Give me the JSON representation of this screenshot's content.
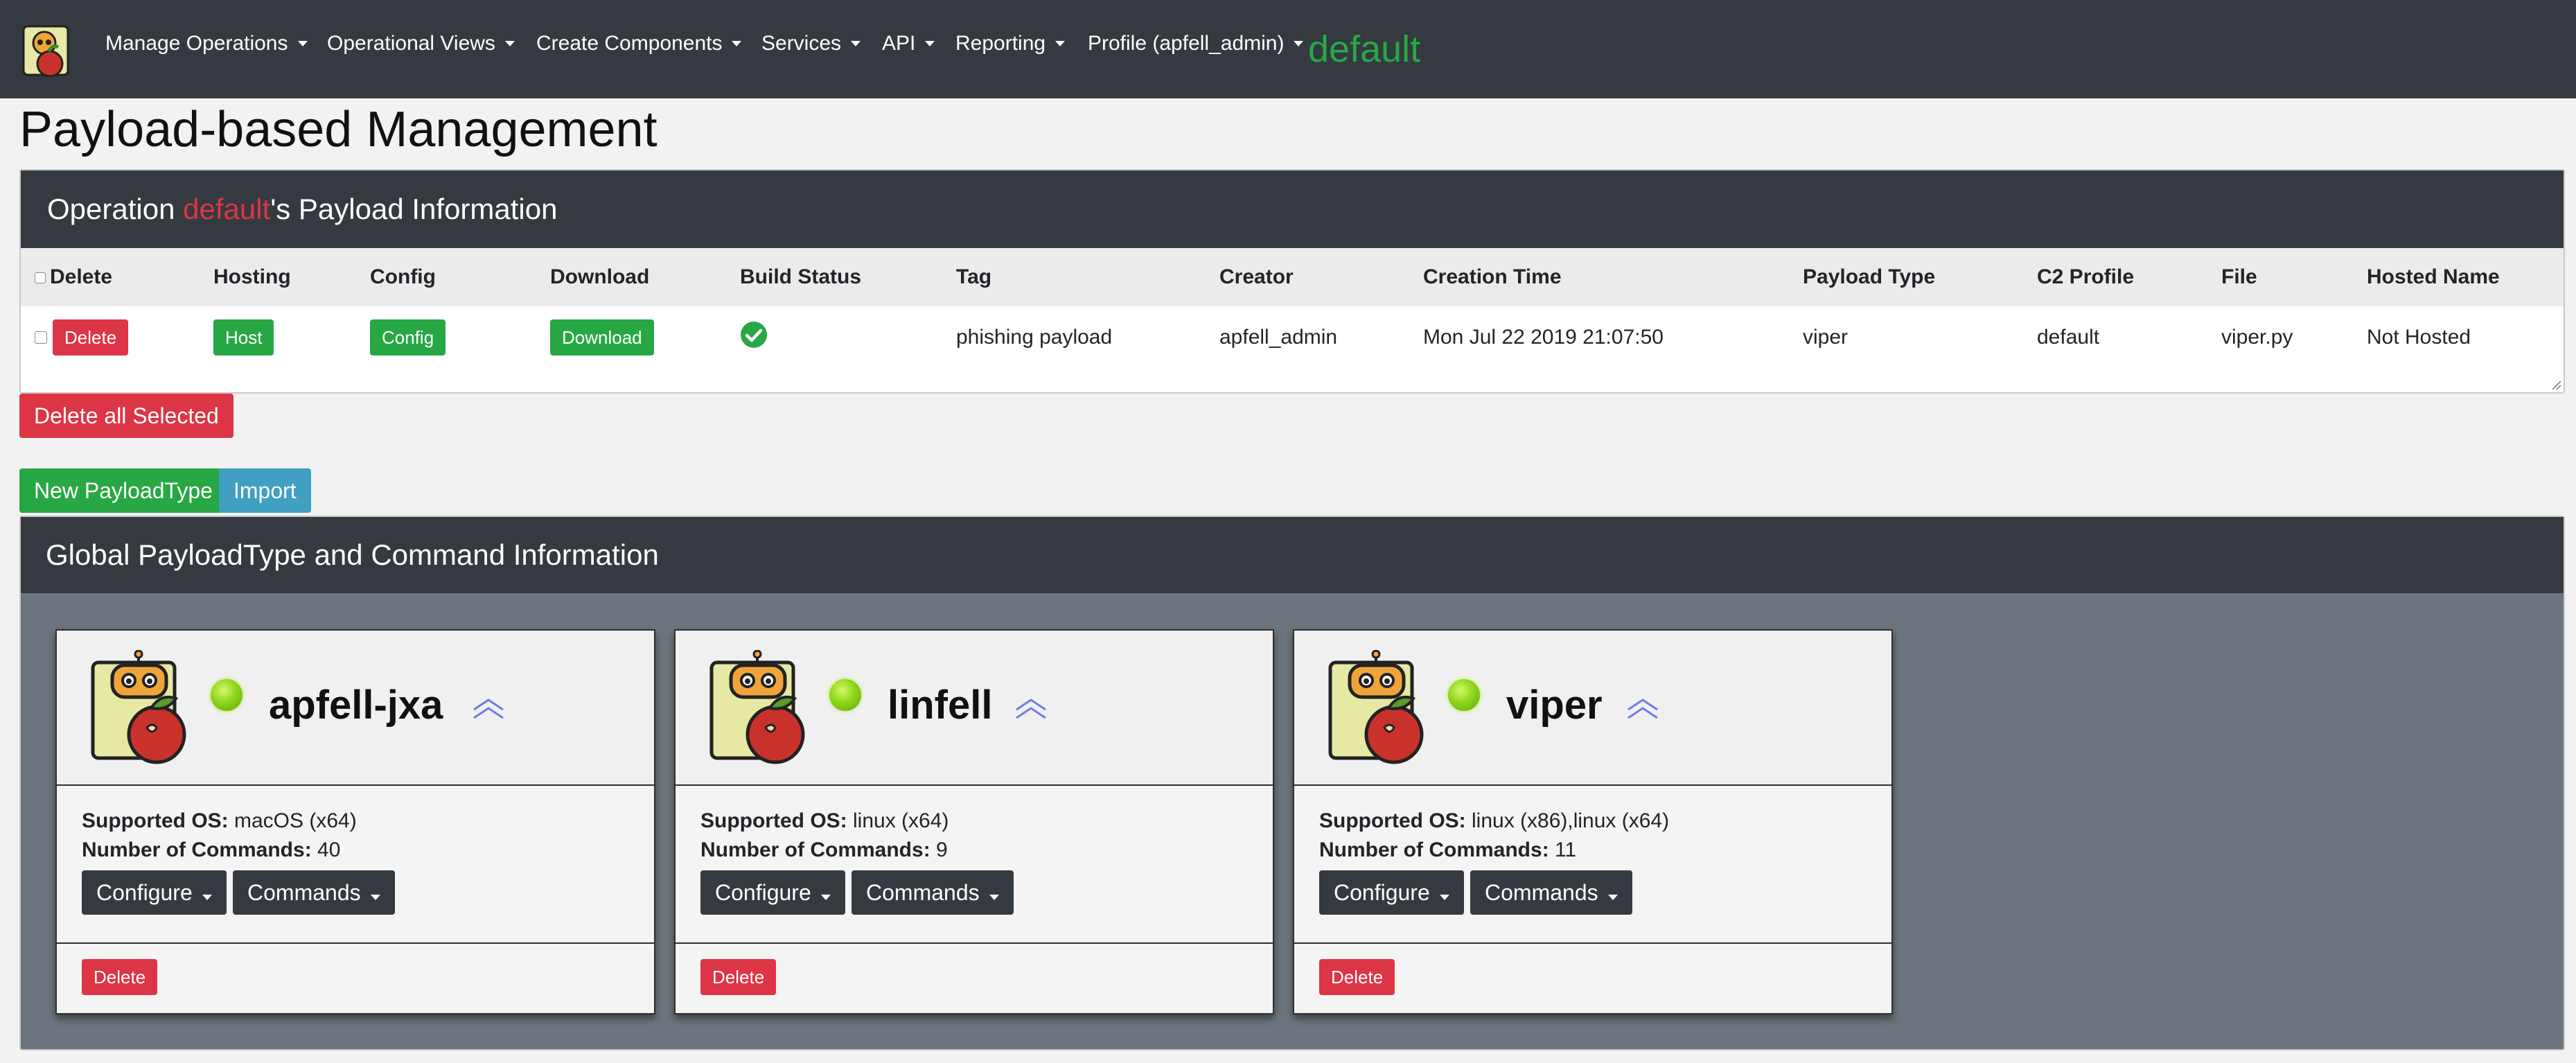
{
  "navbar": {
    "items": [
      {
        "label": "Manage Operations"
      },
      {
        "label": "Operational Views"
      },
      {
        "label": "Create Components"
      },
      {
        "label": "Services"
      },
      {
        "label": "API"
      },
      {
        "label": "Reporting"
      },
      {
        "label": "Profile (apfell_admin)"
      }
    ],
    "current_operation": "default"
  },
  "page_title": "Payload-based Management",
  "operation_panel": {
    "title_prefix": "Operation ",
    "operation_name": "default",
    "title_suffix": "'s Payload Information",
    "columns": [
      "Delete",
      "Hosting",
      "Config",
      "Download",
      "Build Status",
      "Tag",
      "Creator",
      "Creation Time",
      "Payload Type",
      "C2 Profile",
      "File",
      "Hosted Name"
    ],
    "rows": [
      {
        "delete_label": "Delete",
        "host_label": "Host",
        "config_label": "Config",
        "download_label": "Download",
        "build_status_icon": "check-circle-icon",
        "tag": "phishing payload",
        "creator": "apfell_admin",
        "creation_time": "Mon Jul 22 2019 21:07:50",
        "payload_type": "viper",
        "c2_profile": "default",
        "file": "viper.py",
        "hosted_name": "Not Hosted"
      }
    ]
  },
  "actions": {
    "delete_all_selected": "Delete all Selected",
    "new_payload_type": "New PayloadType",
    "import": "Import"
  },
  "global_panel": {
    "title": "Global PayloadType and Command Information",
    "supported_os_label": "Supported OS:",
    "num_commands_label": "Number of Commands:",
    "configure_label": "Configure",
    "commands_label": "Commands",
    "delete_label": "Delete",
    "cards": [
      {
        "name": "apfell-jxa",
        "supported_os": "macOS (x64)",
        "num_commands": "40"
      },
      {
        "name": "linfell",
        "supported_os": "linux (x64)",
        "num_commands": "9"
      },
      {
        "name": "viper",
        "supported_os": "linux (x86),linux (x64)",
        "num_commands": "11"
      }
    ]
  },
  "colors": {
    "navbar": "#343a40",
    "success": "#28a745",
    "danger": "#dc3545",
    "info": "#3fa0c1",
    "panel_body": "#6c757d"
  }
}
